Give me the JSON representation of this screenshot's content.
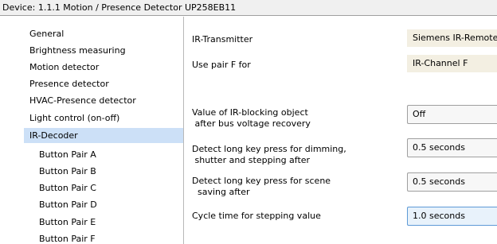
{
  "window": {
    "title": "Device: 1.1.1  Motion / Presence Detector UP258EB11"
  },
  "sidebar": {
    "items": [
      {
        "label": "General"
      },
      {
        "label": "Brightness measuring"
      },
      {
        "label": "Motion detector"
      },
      {
        "label": "Presence detector"
      },
      {
        "label": "HVAC-Presence detector"
      },
      {
        "label": "Light control (on-off)"
      },
      {
        "label": "IR-Decoder",
        "selected": true
      },
      {
        "label": "Button Pair A"
      },
      {
        "label": "Button Pair B"
      },
      {
        "label": "Button Pair C"
      },
      {
        "label": "Button Pair D"
      },
      {
        "label": "Button Pair E"
      },
      {
        "label": "Button Pair F"
      }
    ]
  },
  "params": [
    {
      "label": "IR-Transmitter",
      "value": "Siemens IR-Remote",
      "kind": "static"
    },
    {
      "label": "Use pair F for",
      "value": "IR-Channel F",
      "kind": "static"
    },
    {
      "label_line1": "Value of IR-blocking object",
      "label_line2": " after bus voltage recovery",
      "value": "Off",
      "kind": "dropdown"
    },
    {
      "label_line1": "Detect long key press for dimming,",
      "label_line2": " shutter and stepping after",
      "value": "0.5 seconds",
      "kind": "dropdown"
    },
    {
      "label_line1": "Detect long key press for scene",
      "label_line2": "  saving after",
      "value": "0.5 seconds",
      "kind": "dropdown"
    },
    {
      "label": "Cycle time for stepping value",
      "value": "1.0 seconds",
      "kind": "dropdown",
      "focused": true
    }
  ],
  "colors": {
    "selected_bg": "#cce0f7",
    "static_value_bg": "#f3efe2",
    "focus_border": "#5e9ad6"
  }
}
